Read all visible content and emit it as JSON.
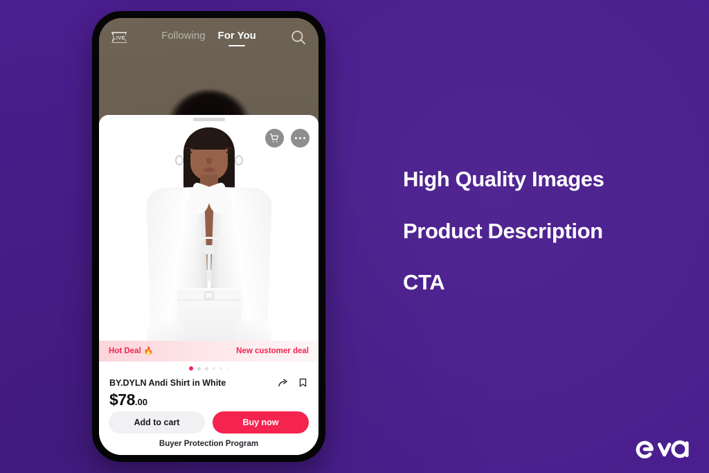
{
  "theme": {
    "background_color": "#4A1E8E",
    "accent_color": "#F5244F",
    "text_on_dark": "#FFFFFF"
  },
  "phone": {
    "top_nav": {
      "live_label": "LIVE",
      "tabs": [
        {
          "label": "Following",
          "active": false
        },
        {
          "label": "For You",
          "active": true
        }
      ],
      "search_icon": "search-icon"
    },
    "product_card": {
      "actions": [
        {
          "icon": "shopping-cart-icon",
          "name": "cart-button"
        },
        {
          "icon": "more-options-icon",
          "name": "more-button"
        }
      ],
      "hot_deal": {
        "left_label": "Hot Deal",
        "flame_icon": "🔥",
        "right_label": "New customer deal"
      },
      "carousel": {
        "active_index": 0,
        "dots": [
          {
            "size": 6,
            "opacity": 1.0,
            "active": true
          },
          {
            "size": 5,
            "opacity": 0.9,
            "active": false
          },
          {
            "size": 5,
            "opacity": 0.75,
            "active": false
          },
          {
            "size": 4.5,
            "opacity": 0.6,
            "active": false
          },
          {
            "size": 4,
            "opacity": 0.45,
            "active": false
          },
          {
            "size": 3,
            "opacity": 0.3,
            "active": false
          }
        ]
      },
      "title": "BY.DYLN Andi Shirt in White",
      "title_icons": [
        {
          "icon": "share-icon",
          "name": "share-button"
        },
        {
          "icon": "bookmark-icon",
          "name": "bookmark-button"
        }
      ],
      "price": {
        "amount": "$78",
        "cents": ".00"
      },
      "cta": {
        "secondary_label": "Add to cart",
        "primary_label": "Buy now"
      },
      "footer_note": "Buyer Protection Program"
    }
  },
  "annotations": {
    "headings": [
      "High Quality Images",
      "Product Description",
      "CTA"
    ]
  },
  "brand": {
    "logo_text": "eva"
  }
}
